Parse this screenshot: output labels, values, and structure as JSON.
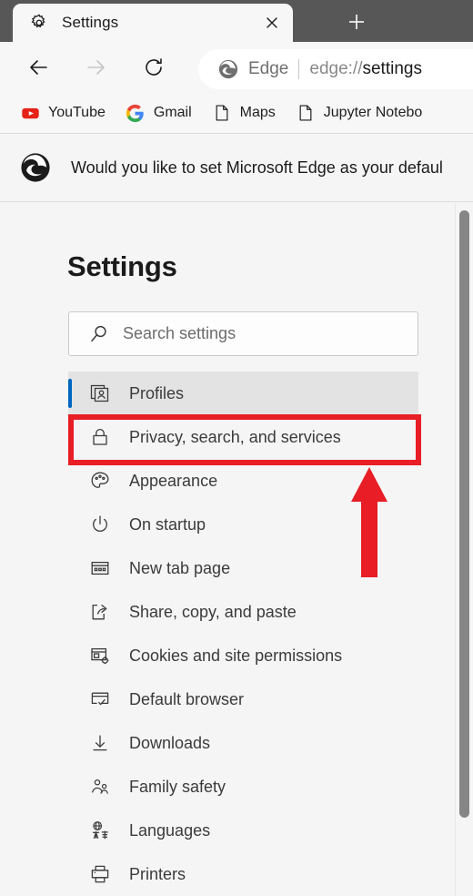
{
  "window": {
    "titlebar_color": "#575757",
    "tab": {
      "favicon": "gear-icon",
      "title": "Settings",
      "close_label": "×"
    },
    "new_tab_label": "+"
  },
  "toolbar": {
    "back_label": "←",
    "forward_label": "→",
    "reload_label": "↻",
    "omnibox": {
      "brand_icon": "edge-logo-icon",
      "brand_label": "Edge",
      "url_scheme": "edge://",
      "url_path": "settings"
    }
  },
  "bookmarks": [
    {
      "icon": "youtube-icon",
      "label": "YouTube"
    },
    {
      "icon": "google-icon",
      "label": "Gmail"
    },
    {
      "icon": "page-icon",
      "label": "Maps"
    },
    {
      "icon": "page-icon",
      "label": "Jupyter Notebo"
    }
  ],
  "infobar": {
    "icon": "edge-logo-icon",
    "message": "Would you like to set Microsoft Edge as your defaul"
  },
  "settings": {
    "page_title": "Settings",
    "search": {
      "icon": "search-icon",
      "placeholder": "Search settings",
      "value": ""
    },
    "nav_items": [
      {
        "icon": "profiles-icon",
        "label": "Profiles",
        "selected": true,
        "annotated": false
      },
      {
        "icon": "lock-icon",
        "label": "Privacy, search, and services",
        "selected": false,
        "annotated": true
      },
      {
        "icon": "palette-icon",
        "label": "Appearance",
        "selected": false,
        "annotated": false
      },
      {
        "icon": "power-icon",
        "label": "On startup",
        "selected": false,
        "annotated": false
      },
      {
        "icon": "newtab-icon",
        "label": "New tab page",
        "selected": false,
        "annotated": false
      },
      {
        "icon": "share-icon",
        "label": "Share, copy, and paste",
        "selected": false,
        "annotated": false
      },
      {
        "icon": "cookies-icon",
        "label": "Cookies and site permissions",
        "selected": false,
        "annotated": false
      },
      {
        "icon": "defaultbrowser-icon",
        "label": "Default browser",
        "selected": false,
        "annotated": false
      },
      {
        "icon": "download-icon",
        "label": "Downloads",
        "selected": false,
        "annotated": false
      },
      {
        "icon": "family-icon",
        "label": "Family safety",
        "selected": false,
        "annotated": false
      },
      {
        "icon": "languages-icon",
        "label": "Languages",
        "selected": false,
        "annotated": false
      },
      {
        "icon": "printer-icon",
        "label": "Printers",
        "selected": false,
        "annotated": false
      }
    ]
  },
  "annotations": {
    "highlight_color": "#e81d25",
    "box_target": "Privacy, search, and services",
    "arrow_direction": "up",
    "arrow_points_to": "Privacy, search, and services"
  },
  "colors": {
    "accent_blue": "#0067c0",
    "selected_row_bg": "#e3e3e3",
    "page_bg": "#f5f5f5",
    "chrome_bg": "#f7f7f7",
    "annotation_red": "#e81d25"
  }
}
